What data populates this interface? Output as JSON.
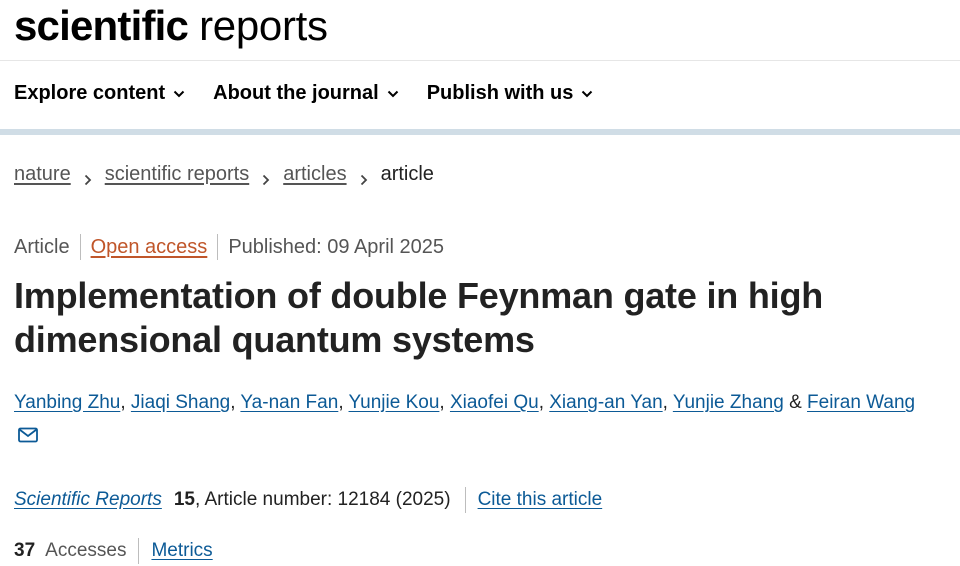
{
  "brand": {
    "bold": "scientific",
    "light": "reports"
  },
  "nav": {
    "items": [
      {
        "label": "Explore content"
      },
      {
        "label": "About the journal"
      },
      {
        "label": "Publish with us"
      }
    ]
  },
  "breadcrumb": {
    "items": [
      "nature",
      "scientific reports",
      "articles"
    ],
    "current": "article"
  },
  "meta": {
    "type": "Article",
    "open_access": "Open access",
    "published": "Published: 09 April 2025"
  },
  "title": "Implementation of double Feynman gate in high dimensional quantum systems",
  "authors": {
    "names": [
      "Yanbing Zhu",
      "Jiaqi Shang",
      "Ya-nan Fan",
      "Yunjie Kou",
      "Xiaofei Qu",
      "Xiang-an Yan",
      "Yunjie Zhang",
      "Feiran Wang"
    ],
    "comma": ",",
    "and": "&"
  },
  "citation": {
    "journal": "Scientific Reports",
    "volume": "15",
    "article_number": ", Article number: 12184 (2025)",
    "cite_link": "Cite this article"
  },
  "metrics": {
    "accesses_count": "37",
    "accesses_label": "Accesses",
    "metrics_link": "Metrics"
  },
  "colors": {
    "link": "#0c5a96",
    "open_access": "#c0562a",
    "nav_rule": "#d0dde6"
  },
  "icons": {
    "nav_dropdown": "chevron-down-icon",
    "breadcrumb_separator": "chevron-right-icon",
    "corresponding_author": "envelope-icon"
  }
}
